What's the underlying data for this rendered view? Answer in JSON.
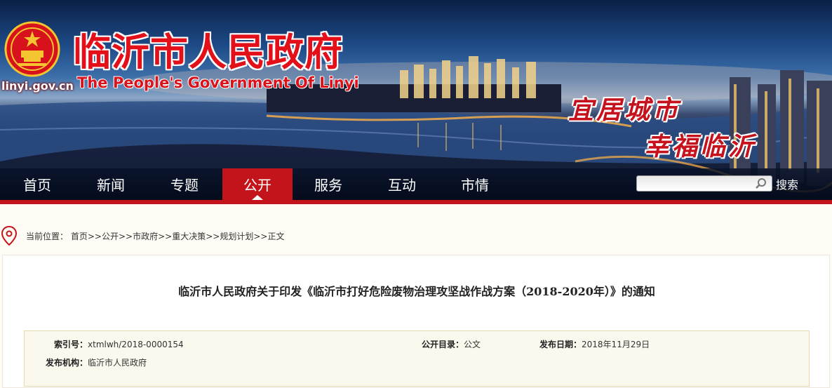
{
  "header": {
    "domain": "linyi.gov.cn",
    "title_cn": "临沂市人民政府",
    "title_en": "The People's Government Of Linyi",
    "slogan_line1": "宜居城市",
    "slogan_line2": "幸福临沂"
  },
  "nav": {
    "items": [
      {
        "label": "首页",
        "active": false
      },
      {
        "label": "新闻",
        "active": false
      },
      {
        "label": "专题",
        "active": false
      },
      {
        "label": "公开",
        "active": true
      },
      {
        "label": "服务",
        "active": false
      },
      {
        "label": "互动",
        "active": false
      },
      {
        "label": "市情",
        "active": false
      }
    ],
    "search_value": "",
    "search_button": "搜索"
  },
  "breadcrumb": {
    "prefix": "当前位置：",
    "items": [
      "首页",
      "公开",
      "市政府",
      "重大决策",
      "规划计划",
      "正文"
    ],
    "separator": ">>"
  },
  "document": {
    "title": "临沂市人民政府关于印发《临沂市打好危险废物治理攻坚战作战方案（2018-2020年）》的通知",
    "index_label": "索引号：",
    "index_value": "xtmlwh/2018-0000154",
    "catalog_label": "公开目录：",
    "catalog_value": "公文",
    "date_label": "发布日期：",
    "date_value": "2018年11月29日",
    "org_label": "发布机构：",
    "org_value": "临沂市人民政府"
  },
  "colors": {
    "brand_red": "#c4141b",
    "page_bg": "#fffcf6",
    "meta_bg": "#fbf8ee"
  }
}
